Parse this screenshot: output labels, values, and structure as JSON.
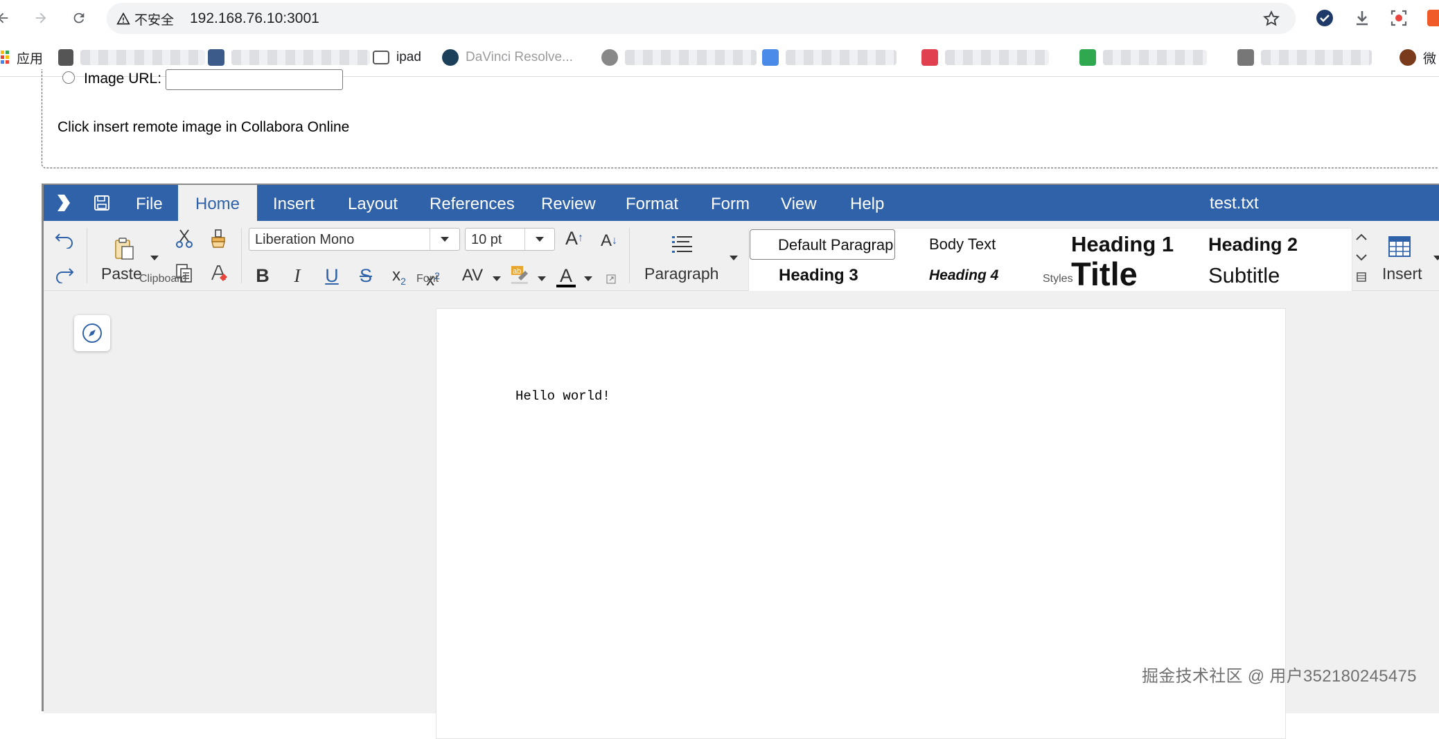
{
  "browser": {
    "security_label": "不安全",
    "url": "192.168.76.10:3001"
  },
  "bookmarks": {
    "apps_label": "应用",
    "items": [
      "ipad",
      "DaVinci Resolve..."
    ],
    "last_label": "微"
  },
  "host_page": {
    "image_url_label": "Image URL:",
    "image_url_value": "",
    "instruction": "Click insert remote image in Collabora Online"
  },
  "collabora": {
    "menu": {
      "file": "File",
      "home": "Home",
      "insert": "Insert",
      "layout": "Layout",
      "references": "References",
      "review": "Review",
      "format": "Format",
      "form": "Form",
      "view": "View",
      "help": "Help"
    },
    "document_name": "test.txt",
    "ribbon": {
      "paste_label": "Paste",
      "clipboard_group": "Clipboard",
      "font_name": "Liberation Mono",
      "font_size": "10 pt",
      "font_group": "Font",
      "paragraph_label": "Paragraph",
      "styles_group": "Styles",
      "insert_label": "Insert",
      "bold": "B",
      "italic": "I",
      "underline": "U",
      "strike": "S",
      "spacing": "AV",
      "font_color": "A",
      "grow": "A",
      "shrink": "A"
    },
    "styles": [
      "Default Paragraph Style",
      "Body Text",
      "Heading 1",
      "Heading 2",
      "Heading 3",
      "Heading 4",
      "Title",
      "Subtitle"
    ],
    "document_text": "Hello world!"
  },
  "watermark": "掘金技术社区 @ 用户352180245475",
  "colors": {
    "menubar": "#2f62a8",
    "ribbon_bg": "#f0f0f0",
    "icon_blue": "#2f62a8"
  }
}
